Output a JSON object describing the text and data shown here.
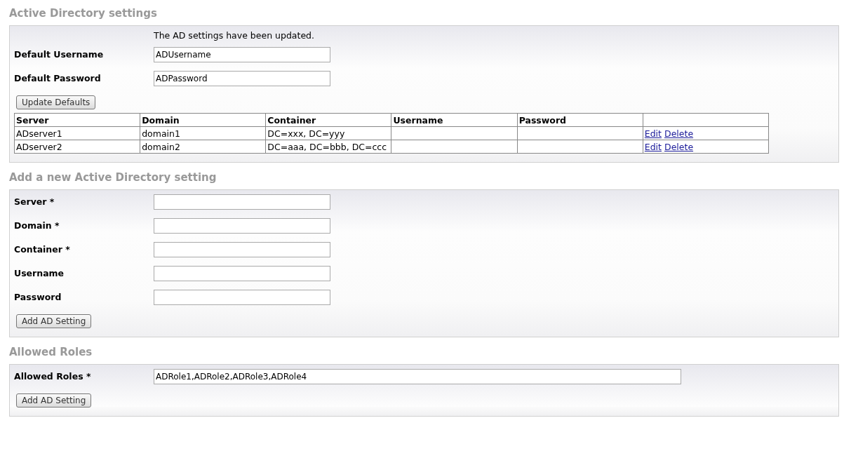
{
  "sections": [
    {
      "kind": "defaults",
      "title": "Active Directory settings",
      "message": "The AD settings have been updated.",
      "fields": [
        {
          "label": "Default Username",
          "value": "ADUsername"
        },
        {
          "label": "Default Password",
          "value": "ADPassword"
        }
      ],
      "button": "Update Defaults",
      "table": {
        "columns": [
          "Server",
          "Domain",
          "Container",
          "Username",
          "Password"
        ],
        "rows": [
          {
            "cells": [
              "ADserver1",
              "domain1",
              "DC=xxx, DC=yyy"
            ],
            "actions": [
              "Edit",
              "Delete"
            ]
          },
          {
            "cells": [
              "ADserver2",
              "domain2",
              "DC=aaa, DC=bbb, DC=ccc"
            ],
            "actions": [
              "Edit",
              "Delete"
            ]
          }
        ]
      }
    },
    {
      "kind": "form",
      "title": "Add a new Active Directory setting",
      "fields": [
        {
          "label": "Server *"
        },
        {
          "label": "Domain *"
        },
        {
          "label": "Container *"
        },
        {
          "label": "Username"
        },
        {
          "label": "Password"
        }
      ],
      "button": "Add AD Setting"
    },
    {
      "kind": "roles",
      "title": "Allowed Roles",
      "fields": [
        {
          "label": "Allowed Roles *",
          "value": "ADRole1,ADRole2,ADRole3,ADRole4"
        }
      ],
      "button": "Add AD Setting"
    }
  ]
}
